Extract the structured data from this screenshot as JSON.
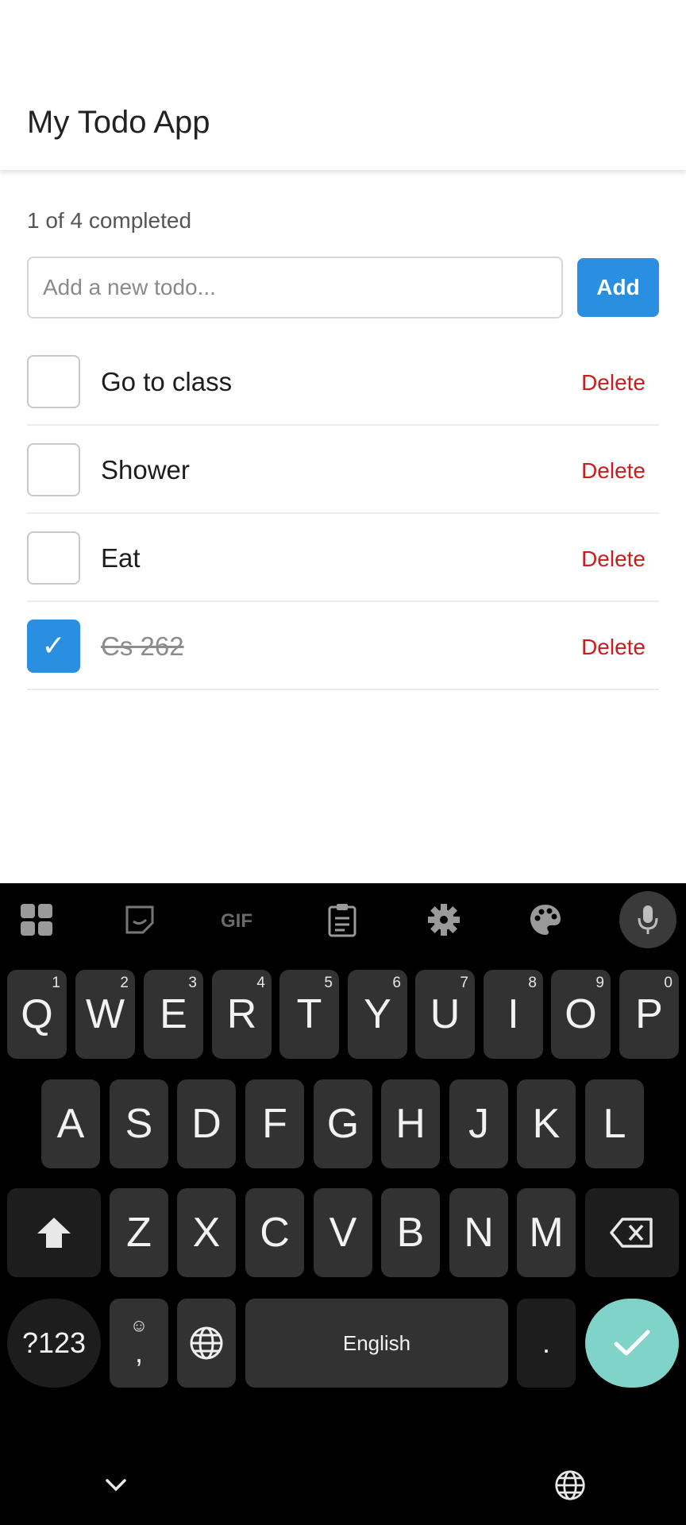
{
  "app": {
    "title": "My Todo App",
    "summary": "1 of 4 completed",
    "new_todo_placeholder": "Add a new todo...",
    "add_label": "Add",
    "accent_color": "#2a8fe0",
    "delete_color": "#c81e1e"
  },
  "todos": [
    {
      "text": "Go to class",
      "completed": false,
      "delete_label": "Delete"
    },
    {
      "text": "Shower",
      "completed": false,
      "delete_label": "Delete"
    },
    {
      "text": "Eat",
      "completed": false,
      "delete_label": "Delete"
    },
    {
      "text": "Cs 262",
      "completed": true,
      "delete_label": "Delete",
      "check_glyph": "✓"
    }
  ],
  "keyboard": {
    "toolbar_icons": [
      "apps-grid-icon",
      "sticker-icon",
      "gif-icon",
      "clipboard-icon",
      "settings-gear-icon",
      "palette-icon",
      "mic-icon"
    ],
    "row1": [
      {
        "label": "Q",
        "hint": "1"
      },
      {
        "label": "W",
        "hint": "2"
      },
      {
        "label": "E",
        "hint": "3"
      },
      {
        "label": "R",
        "hint": "4"
      },
      {
        "label": "T",
        "hint": "5"
      },
      {
        "label": "Y",
        "hint": "6"
      },
      {
        "label": "U",
        "hint": "7"
      },
      {
        "label": "I",
        "hint": "8"
      },
      {
        "label": "O",
        "hint": "9"
      },
      {
        "label": "P",
        "hint": "0"
      }
    ],
    "row2": [
      "A",
      "S",
      "D",
      "F",
      "G",
      "H",
      "J",
      "K",
      "L"
    ],
    "row3": [
      "Z",
      "X",
      "C",
      "V",
      "B",
      "N",
      "M"
    ],
    "symbols_label": "?123",
    "comma_label": ",",
    "emoji_glyph": "☺",
    "space_label": "English",
    "period_label": ".",
    "enter_color": "#7fd3c8"
  }
}
